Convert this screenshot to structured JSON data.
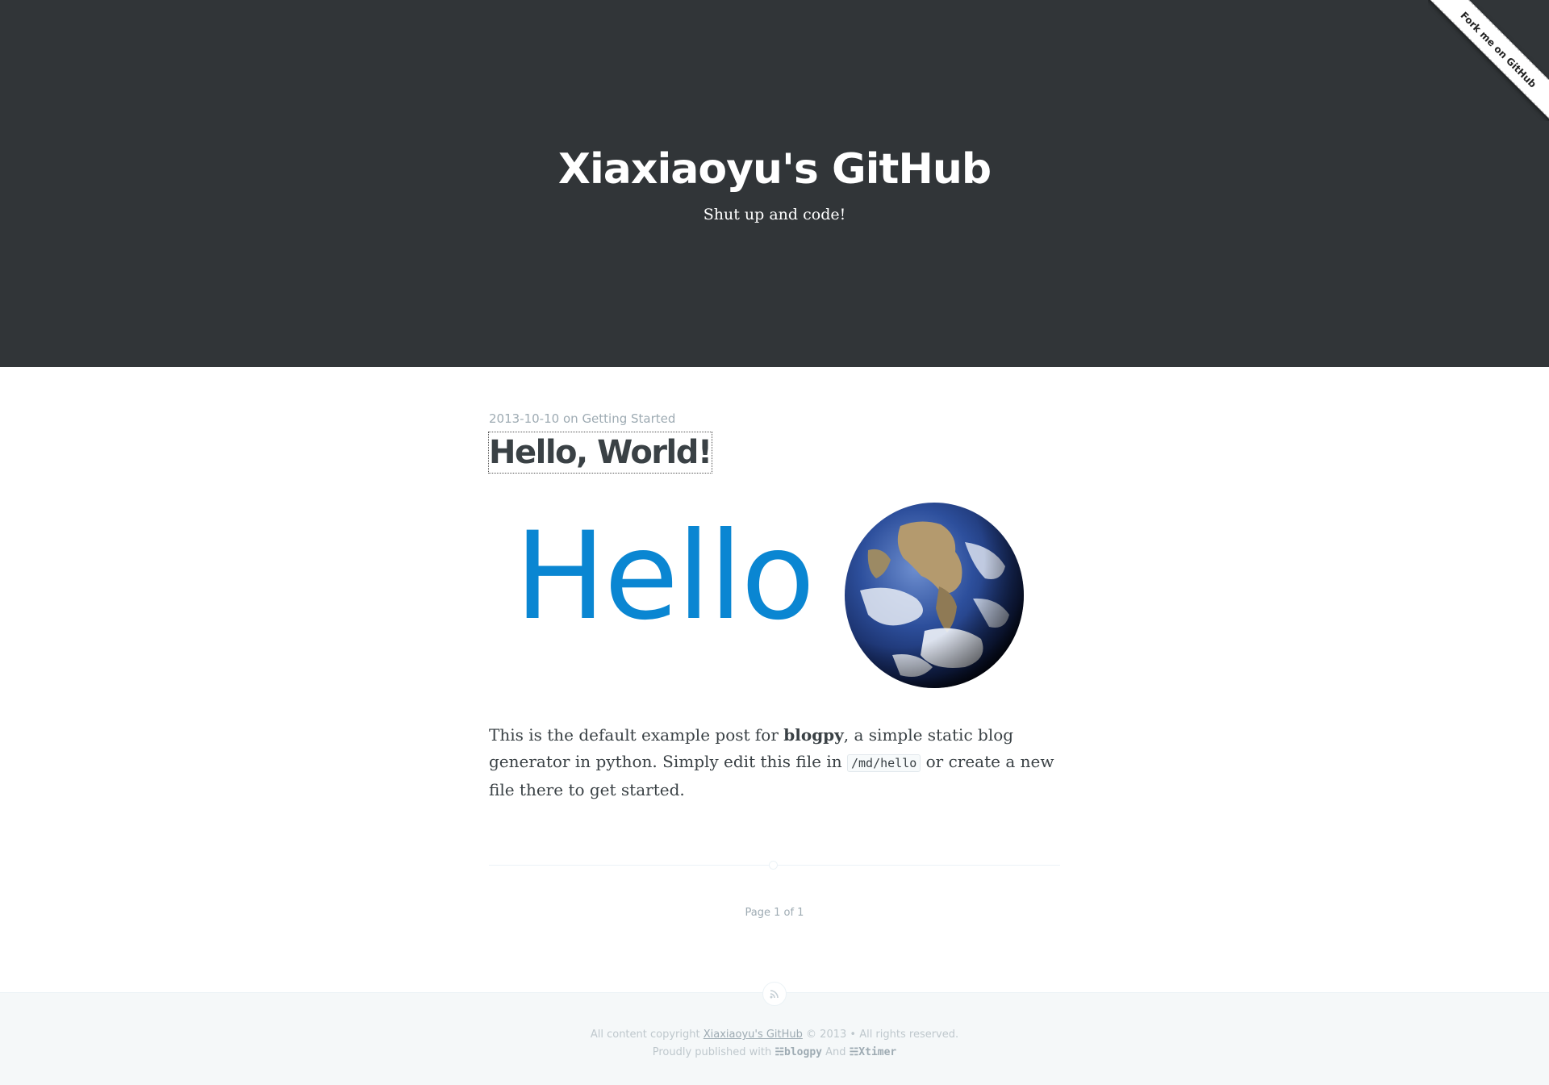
{
  "header": {
    "title": "Xiaxiaoyu's GitHub",
    "description": "Shut up and code!",
    "fork_ribbon": "Fork me on GitHub"
  },
  "post": {
    "date": "2013-10-10",
    "on": "on",
    "category": "Getting Started",
    "title": "Hello, World!",
    "hero_text": "Hello",
    "content": {
      "part1": "This is the default example post for ",
      "bold": "blogpy",
      "part2": ", a simple static blog generator in python. Simply edit this file in ",
      "code": "/md/hello",
      "part3": " or create a new file there to get started."
    }
  },
  "pagination": {
    "text": "Page 1 of 1"
  },
  "footer": {
    "copyright_prefix": "All content copyright ",
    "site_link": "Xiaxiaoyu's GitHub",
    "copyright_suffix": " © 2013 • All rights reserved.",
    "published_prefix": "Proudly published with ",
    "brand1": "☵blogpy",
    "and": " And ",
    "brand2": "☵Xtimer"
  },
  "colors": {
    "header_bg": "#313538",
    "hero_blue": "#0a86d2",
    "text": "#3a4145",
    "muted": "#9eabb3"
  },
  "icons": {
    "rss": "rss-icon",
    "globe": "earth-globe-image"
  }
}
